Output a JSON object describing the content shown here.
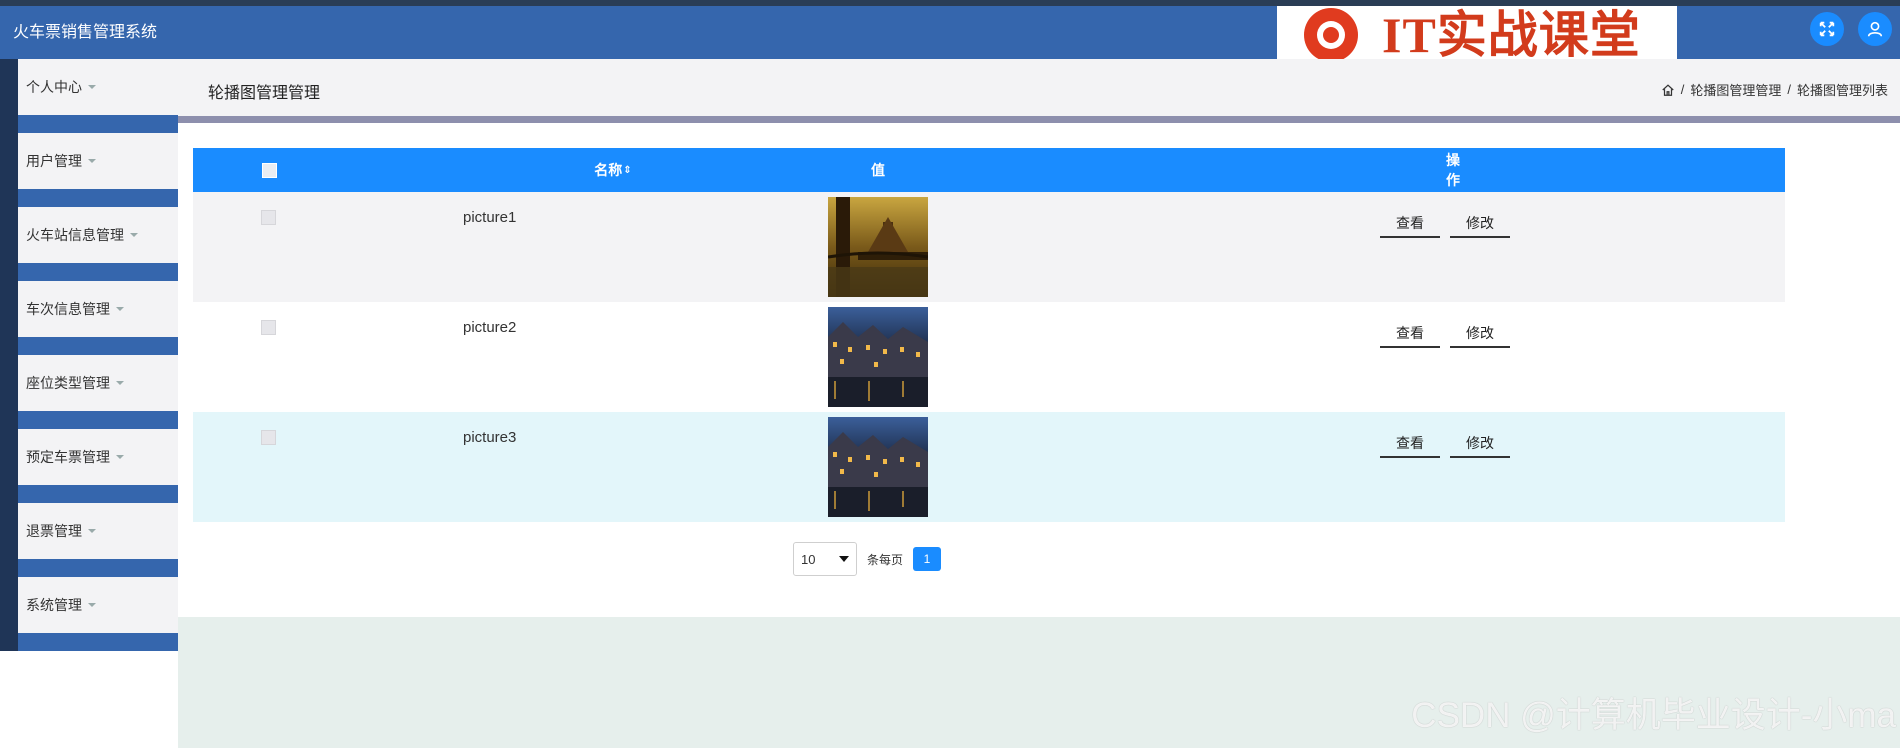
{
  "header": {
    "app_title": "火车票销售管理系统",
    "logo_text": "IT实战课堂",
    "accent": "#3566ad",
    "buttons": [
      {
        "icon": "fullscreen-icon"
      },
      {
        "icon": "user-icon"
      }
    ]
  },
  "sidebar": {
    "items": [
      {
        "label": "个人中心"
      },
      {
        "label": "用户管理"
      },
      {
        "label": "火车站信息管理"
      },
      {
        "label": "车次信息管理"
      },
      {
        "label": "座位类型管理"
      },
      {
        "label": "预定车票管理"
      },
      {
        "label": "退票管理"
      },
      {
        "label": "系统管理"
      }
    ]
  },
  "page": {
    "title": "轮播图管理管理",
    "breadcrumb": [
      "轮播图管理管理",
      "轮播图管理列表"
    ],
    "breadcrumb_sep": "/",
    "home_icon": "home-icon"
  },
  "table": {
    "columns": {
      "name": "名称",
      "value": "值",
      "actions": "操作"
    },
    "header_color": "#1a8cff",
    "rows": [
      {
        "name": "picture1",
        "image": "old-city-bridge-photo",
        "view": "查看",
        "edit": "修改"
      },
      {
        "name": "picture2",
        "image": "canal-houses-night-photo",
        "view": "查看",
        "edit": "修改"
      },
      {
        "name": "picture3",
        "image": "canal-houses-night-photo",
        "view": "查看",
        "edit": "修改"
      }
    ]
  },
  "pagination": {
    "page_size": "10",
    "per_page_label": "条每页",
    "current_page": "1"
  },
  "watermark": "CSDN @计算机毕业设计-小ma"
}
